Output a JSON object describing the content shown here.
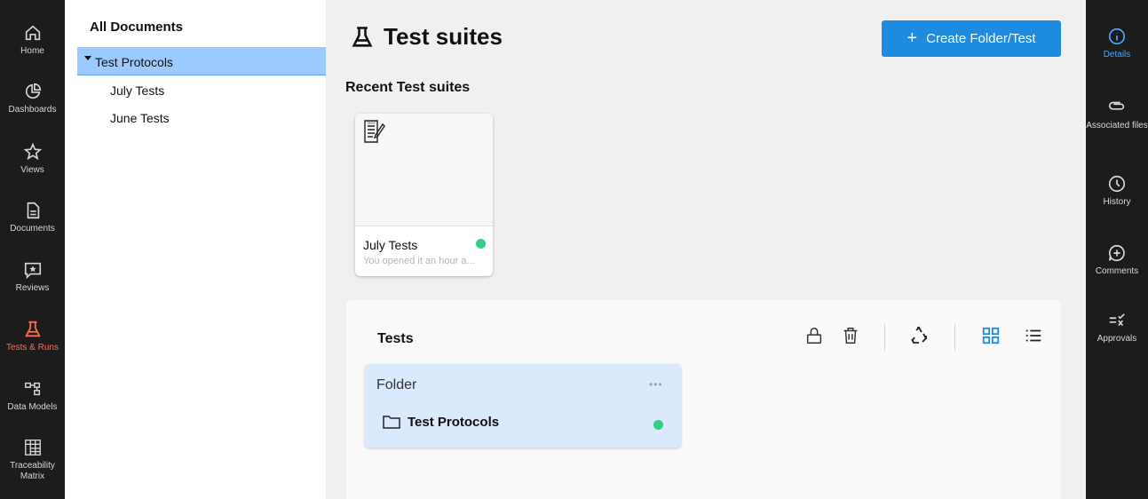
{
  "left_nav": {
    "items": [
      {
        "label": "Home",
        "icon": "home-icon"
      },
      {
        "label": "Dashboards",
        "icon": "pie-chart-icon"
      },
      {
        "label": "Views",
        "icon": "star-icon"
      },
      {
        "label": "Documents",
        "icon": "document-icon"
      },
      {
        "label": "Reviews",
        "icon": "review-icon"
      },
      {
        "label": "Tests & Runs",
        "icon": "flask-icon",
        "active": true
      },
      {
        "label": "Data Models",
        "icon": "data-model-icon"
      },
      {
        "label": "Traceability Matrix",
        "icon": "matrix-icon"
      }
    ],
    "active_color": "#ff6b57"
  },
  "tree": {
    "title": "All Documents",
    "selected": "Test Protocols",
    "children": [
      "July Tests",
      "June Tests"
    ]
  },
  "main": {
    "title": "Test suites",
    "create_button": "Create Folder/Test",
    "recent_title": "Recent Test suites",
    "recent_cards": [
      {
        "name": "July Tests",
        "subtitle": "You opened it an hour a...",
        "status_color": "#34cc86"
      }
    ],
    "tests_panel": {
      "title": "Tests",
      "toolbar": [
        "lock-icon",
        "trash-icon",
        "recycle-icon",
        "grid-view-icon",
        "list-view-icon"
      ],
      "folder_card": {
        "header": "Folder",
        "more": "•••",
        "name": "Test Protocols",
        "status_color": "#34cc86"
      }
    }
  },
  "right_nav": {
    "items": [
      {
        "label": "Details",
        "icon": "info-icon",
        "active": true
      },
      {
        "label": "Associated files",
        "icon": "paperclip-icon"
      },
      {
        "label": "History",
        "icon": "clock-icon"
      },
      {
        "label": "Comments",
        "icon": "comment-add-icon"
      },
      {
        "label": "Approvals",
        "icon": "approvals-icon"
      }
    ],
    "active_color": "#4ea8ff"
  },
  "accent_color": "#1d8ce0"
}
